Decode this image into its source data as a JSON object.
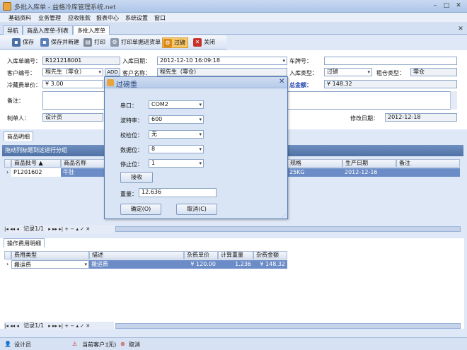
{
  "window": {
    "title": "多批入库单 - 益格冷库管理系统.net"
  },
  "menu": [
    "基础资料",
    "业务管理",
    "应收账款",
    "报表中心",
    "系统设置",
    "窗口"
  ],
  "tabs": [
    "导航",
    "商品入库单-列表",
    "多批入库单"
  ],
  "toolbar": {
    "save": "保存",
    "save_new": "保存并新建",
    "print": "打印",
    "print_preview": "打印单据进货单",
    "weigh": "过磅",
    "close": "关闭"
  },
  "form": {
    "order_no_label": "入库单编号：",
    "order_no": "R121218001",
    "in_date_label": "入库日期：",
    "in_date": "2012-12-10  16:09:18",
    "plate_label": "车牌号：",
    "plate": "",
    "customer_no_label": "客户编号：",
    "customer_no": "程先生（零仓）",
    "add": "ADD",
    "customer_name_label": "客户名称：",
    "customer_name": "程先生（零仓）",
    "in_type_label": "入库类型：",
    "in_type": "过磅",
    "rent_type_label": "租仓类型：",
    "rent_type": "零仓",
    "freeze_price_label": "冷藏费单价：",
    "freeze_price": "¥ 3.00",
    "total_label": "总金额：",
    "total": "¥ 148.32",
    "remark_label": "备注：",
    "maker_label": "制单人：",
    "maker": "设计员",
    "modify_date_label": "修改日期：",
    "modify_date": "2012-12-18"
  },
  "goods": {
    "tab": "商品明细",
    "group_hint": "拖动列标题到这进行分组",
    "columns": [
      "商品批号",
      "商品名称",
      "规格",
      "生产日期",
      "备注"
    ],
    "rows": [
      {
        "batch": "P1201602",
        "name": "牛肚",
        "spec": "25KG",
        "date": "2012-12-16",
        "remark": ""
      }
    ],
    "record": "记录1/1"
  },
  "fees": {
    "tab": "操作费用明细",
    "columns": [
      "费用类型",
      "描述",
      "杂费单价",
      "计算重量",
      "杂费金额"
    ],
    "rows": [
      {
        "type": "搬运费",
        "desc": "搬运费",
        "price": "¥ 120.00",
        "weight": "1.236",
        "amount": "¥ 148.32"
      }
    ],
    "record": "记录1/1"
  },
  "dialog": {
    "title": "过磅重",
    "port_label": "串口：",
    "port": "COM2",
    "baud_label": "波特率：",
    "baud": "600",
    "parity_label": "校检位：",
    "parity": "无",
    "databits_label": "数据位：",
    "databits": "8",
    "stopbits_label": "停止位：",
    "stopbits": "1",
    "receive": "接收",
    "weight_label": "重量：",
    "weight": "12.636",
    "ok": "确定(O)",
    "cancel": "取消(C)"
  },
  "status": {
    "user": "设计员",
    "current_customer_label": "当前客户：",
    "current_customer": "(无)",
    "cancel": "取消"
  },
  "colors": {
    "accent": "#4f71a5",
    "selection": "#6b8cc7",
    "highlight": "#f7c76a"
  }
}
